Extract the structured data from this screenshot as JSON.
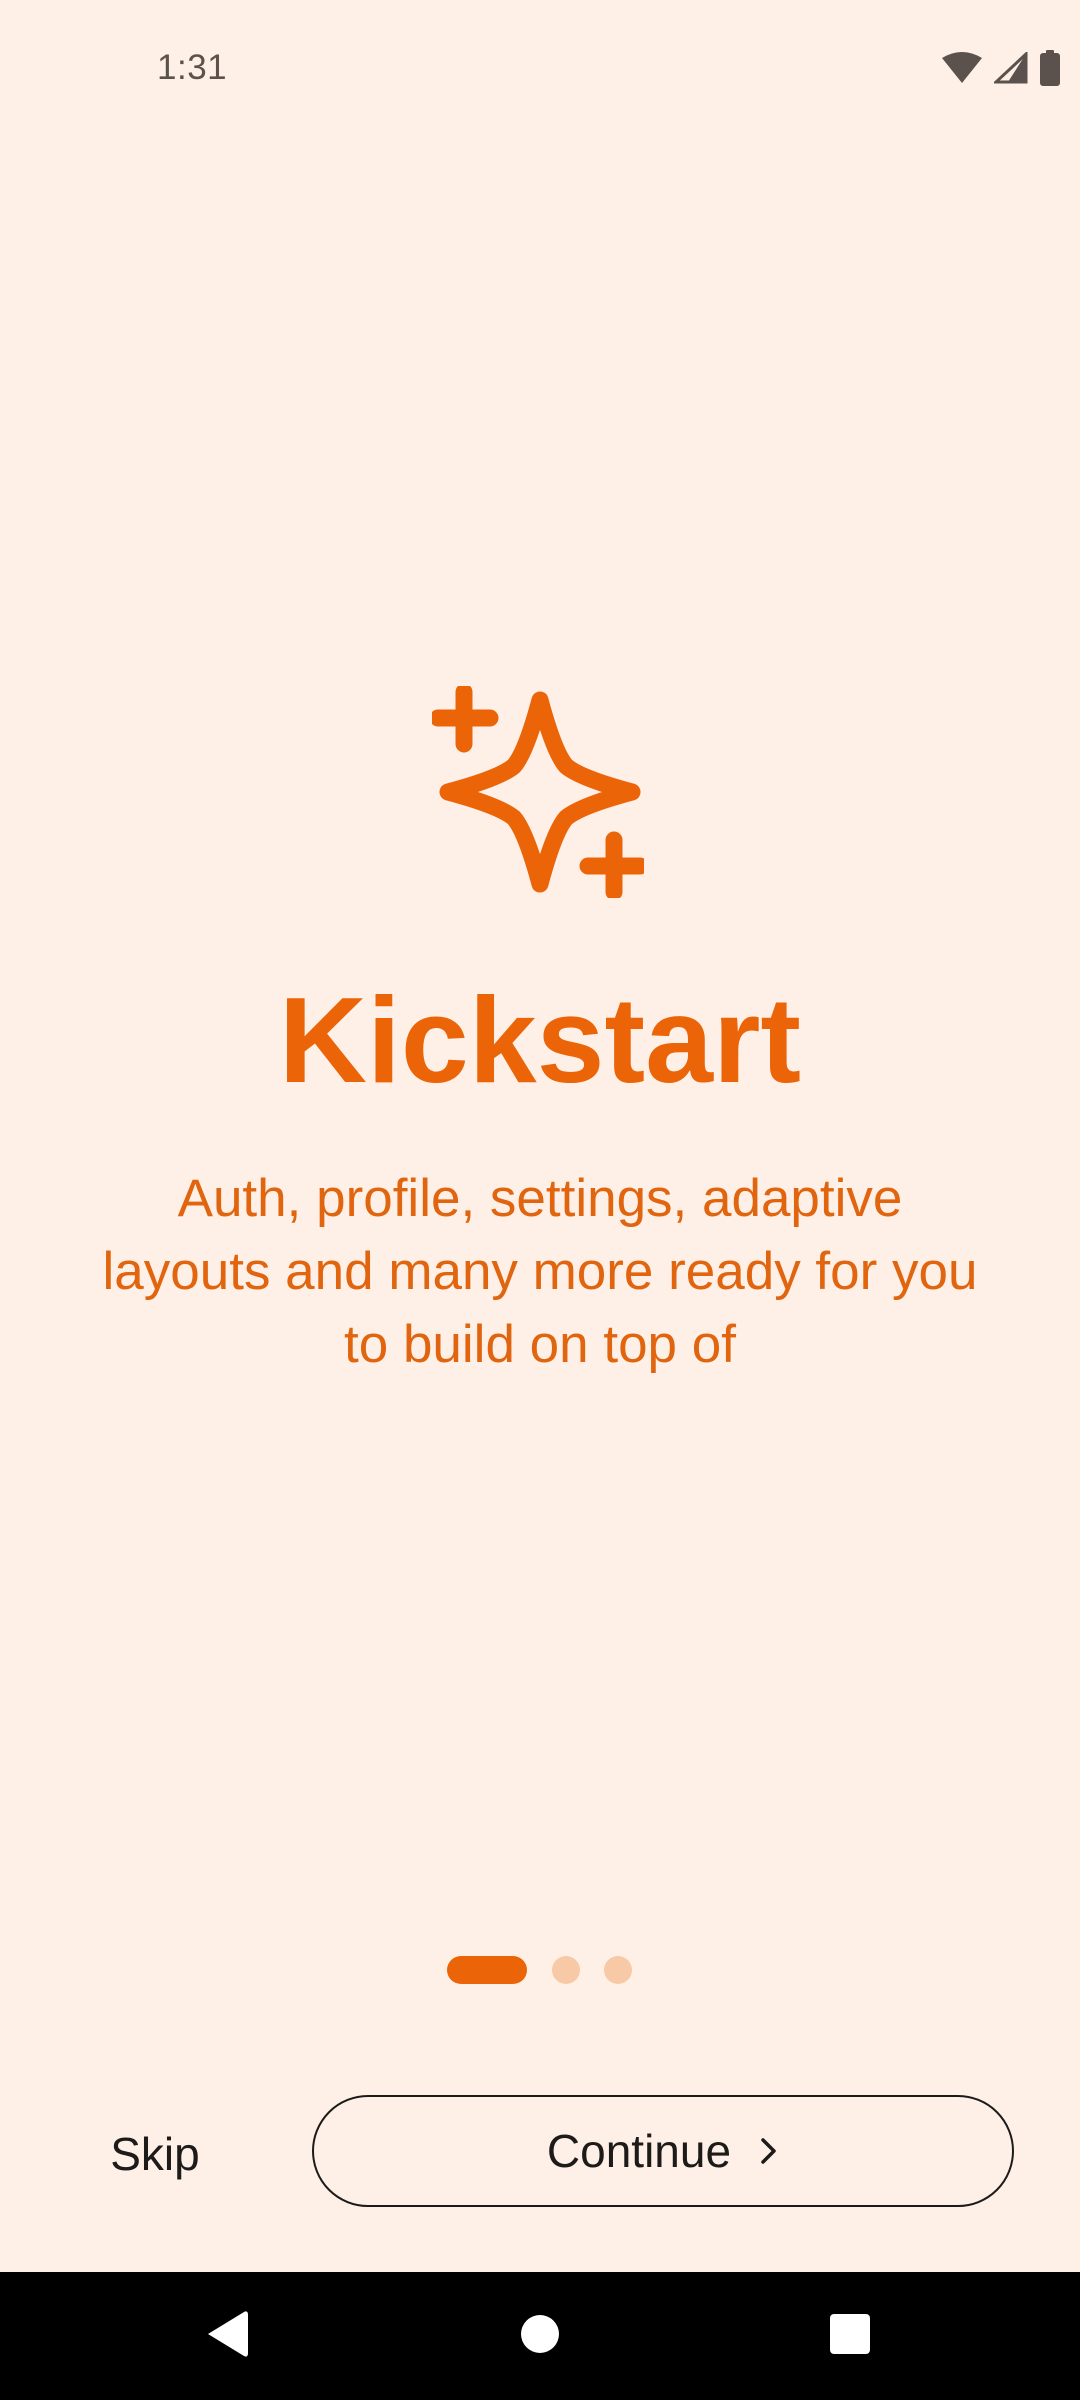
{
  "status_bar": {
    "time": "1:31",
    "icons": [
      "wifi-icon",
      "cellular-signal-icon",
      "battery-icon"
    ]
  },
  "onboarding": {
    "icon": "sparkles-icon",
    "title": "Kickstart",
    "subtitle": "Auth, profile, settings, adaptive layouts and many more ready for you to build on top of",
    "page_indicator": {
      "total_pages": 3,
      "current_page": 1
    }
  },
  "actions": {
    "skip_label": "Skip",
    "continue_label": "Continue",
    "continue_icon": "chevron-right-icon"
  },
  "navigation_bar": {
    "buttons": [
      "back-icon",
      "home-icon",
      "recents-icon"
    ]
  },
  "colors": {
    "background": "#FEF0E7",
    "accent": "#EC6408",
    "indicator_inactive": "#F8C9A6",
    "text_dark": "#1D1B1A"
  }
}
